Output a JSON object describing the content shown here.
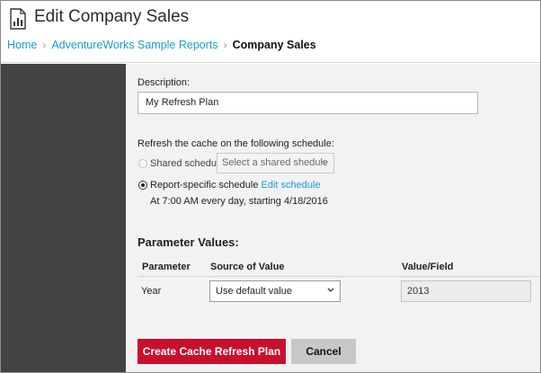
{
  "header": {
    "title": "Edit Company Sales",
    "icon": "report-icon"
  },
  "breadcrumb": {
    "items": [
      "Home",
      "AdventureWorks Sample Reports"
    ],
    "separator": ">",
    "current": "Company Sales"
  },
  "form": {
    "description_label": "Description:",
    "description_value": "My Refresh Plan",
    "schedule_label": "Refresh the cache on the following schedule:",
    "shared_schedule_label": "Shared schedule",
    "shared_schedule_placeholder": "Select a shared shedule",
    "report_schedule_label": "Report-specific schedule",
    "edit_schedule_link": "Edit schedule",
    "schedule_summary": "At 7:00 AM every day, starting 4/18/2016"
  },
  "parameters": {
    "section_title": "Parameter Values:",
    "columns": [
      "Parameter",
      "Source of Value",
      "Value/Field"
    ],
    "rows": [
      {
        "name": "Year",
        "source": "Use default value",
        "value": "2013"
      }
    ]
  },
  "buttons": {
    "create": "Create Cache Refresh Plan",
    "cancel": "Cancel"
  },
  "colors": {
    "accent_link": "#1a9bd7",
    "primary_button": "#c8102e",
    "sidebar": "#444444",
    "content_bg": "#f2f2f2"
  }
}
